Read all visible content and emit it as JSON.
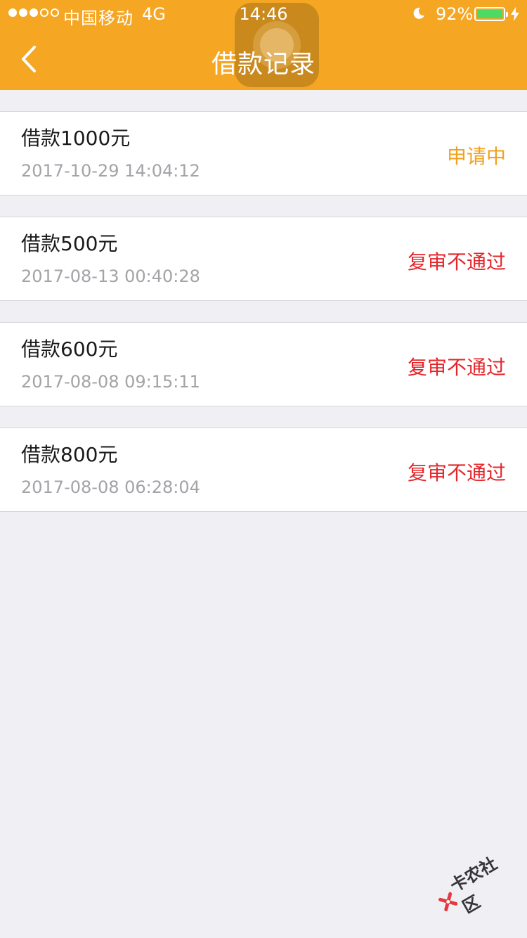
{
  "status_bar": {
    "carrier": "中国移动",
    "network": "4G",
    "time": "14:46",
    "battery_percent": "92%",
    "battery_level": 0.92,
    "signal_strength": 3,
    "signal_max": 5
  },
  "nav": {
    "title": "借款记录",
    "back_icon": "chevron-left-icon"
  },
  "colors": {
    "header_bg": "#f5a623",
    "status_pending": "#f0a11e",
    "status_rejected": "#e4262b",
    "page_bg": "#efeff4"
  },
  "records": [
    {
      "title": "借款1000元",
      "time": "2017-10-29 14:04:12",
      "status": "申请中",
      "status_color": "#f0a11e"
    },
    {
      "title": "借款500元",
      "time": "2017-08-13 00:40:28",
      "status": "复审不通过",
      "status_color": "#e4262b"
    },
    {
      "title": "借款600元",
      "time": "2017-08-08 09:15:11",
      "status": "复审不通过",
      "status_color": "#e4262b"
    },
    {
      "title": "借款800元",
      "time": "2017-08-08 06:28:04",
      "status": "复审不通过",
      "status_color": "#e4262b"
    }
  ],
  "watermark": {
    "text": "卡农社区",
    "icon": "kanong-logo-icon"
  }
}
